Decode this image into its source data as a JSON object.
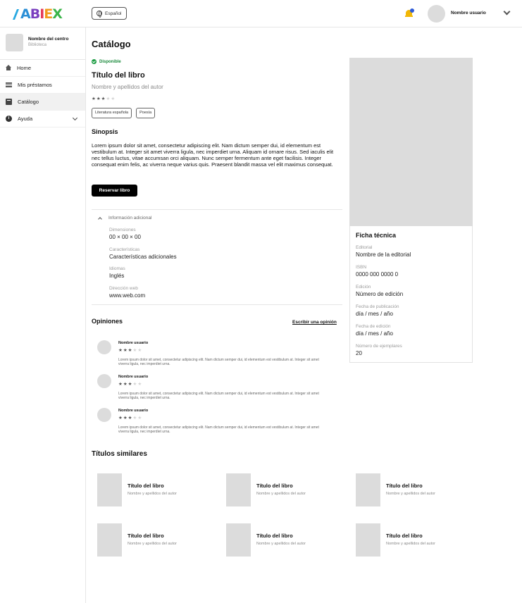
{
  "header": {
    "logo_text": "ABIEX",
    "language": "Español",
    "user_name": "Nombre usuario"
  },
  "sidebar": {
    "center_name": "Nombre del centro",
    "center_type": "Biblioteca",
    "items": [
      {
        "label": "Home",
        "icon": "home-icon"
      },
      {
        "label": "Mis préstamos",
        "icon": "stack-icon"
      },
      {
        "label": "Catálogo",
        "icon": "book-icon",
        "active": true
      },
      {
        "label": "Ayuda",
        "icon": "info-icon"
      }
    ]
  },
  "page": {
    "title": "Catálogo",
    "status": "Disponible",
    "book_title": "Título del libro",
    "book_author": "Nombre y apellidos del autor",
    "rating": 3,
    "rating_max": 5,
    "tags": [
      "Literatura española",
      "Poesía"
    ],
    "synopsis_title": "Sinopsis",
    "synopsis": "Lorem ipsum dolor sit amet, consectetur adipiscing elit. Nam dictum semper dui, id elementum est vestibulum at. Integer sit amet viverra ligula, nec imperdiet urna. Aliquam id ornare risus. Sed iaculis elit nec tellus luctus, vitae accumsan orci aliquam. Nunc semper fermentum ante eget facilisis. Integer consequat enim felis, ac viverra neque varius quis. Praesent blandit massa vel elit maximus consequat.",
    "reserve_label": "Reservar libro"
  },
  "additional": {
    "title": "Información adicional",
    "fields": [
      {
        "label": "Dimensiones",
        "value": "00 × 00 × 00"
      },
      {
        "label": "Características",
        "value": "Características adicionales"
      },
      {
        "label": "Idiomas",
        "value": "Inglés"
      },
      {
        "label": "Dirección web",
        "value": "www.web.com"
      }
    ]
  },
  "reviews": {
    "title": "Opiniones",
    "write_label": "Escribir una opinión",
    "items": [
      {
        "user": "Nombre usuario",
        "rating": 3,
        "text": "Lorem ipsum dolor sit amet, consectetur adipiscing elit. Nam dictum semper dui, id elementum est vestibulum at. Integer sit amet viverra ligula, nec imperdiet urna."
      },
      {
        "user": "Nombre usuario",
        "rating": 3,
        "text": "Lorem ipsum dolor sit amet, consectetur adipiscing elit. Nam dictum semper dui, id elementum est vestibulum at. Integer sit amet viverra ligula, nec imperdiet urna."
      },
      {
        "user": "Nombre usuario",
        "rating": 3,
        "text": "Lorem ipsum dolor sit amet, consectetur adipiscing elit. Nam dictum semper dui, id elementum est vestibulum at. Integer sit amet viverra ligula, nec imperdiet urna."
      }
    ]
  },
  "similar": {
    "title": "Títulos similares",
    "items": [
      {
        "title": "Título del libro",
        "author": "Nombre y apellidos del autor"
      },
      {
        "title": "Título del libro",
        "author": "Nombre y apellidos del autor"
      },
      {
        "title": "Título del libro",
        "author": "Nombre y apellidos del autor"
      },
      {
        "title": "Título del libro",
        "author": "Nombre y apellidos del autor"
      },
      {
        "title": "Título del libro",
        "author": "Nombre y apellidos del autor"
      },
      {
        "title": "Título del libro",
        "author": "Nombre y apellidos del autor"
      }
    ]
  },
  "ficha": {
    "title": "Ficha técnica",
    "fields": [
      {
        "label": "Editorial",
        "value": "Nombre de la editorial"
      },
      {
        "label": "ISBN",
        "value": "0000 000 0000 0"
      },
      {
        "label": "Edición",
        "value": "Número de edición"
      },
      {
        "label": "Fecha de publicación",
        "value": "día / mes / año"
      },
      {
        "label": "Fecha de edición",
        "value": "día / mes / año"
      },
      {
        "label": "Número de ejemplares",
        "value": "20"
      }
    ]
  },
  "colors": {
    "accent": "#000000",
    "status_green": "#1a9c41",
    "notification_bell": "#f2b705",
    "notification_dot": "#2e5bd8"
  }
}
